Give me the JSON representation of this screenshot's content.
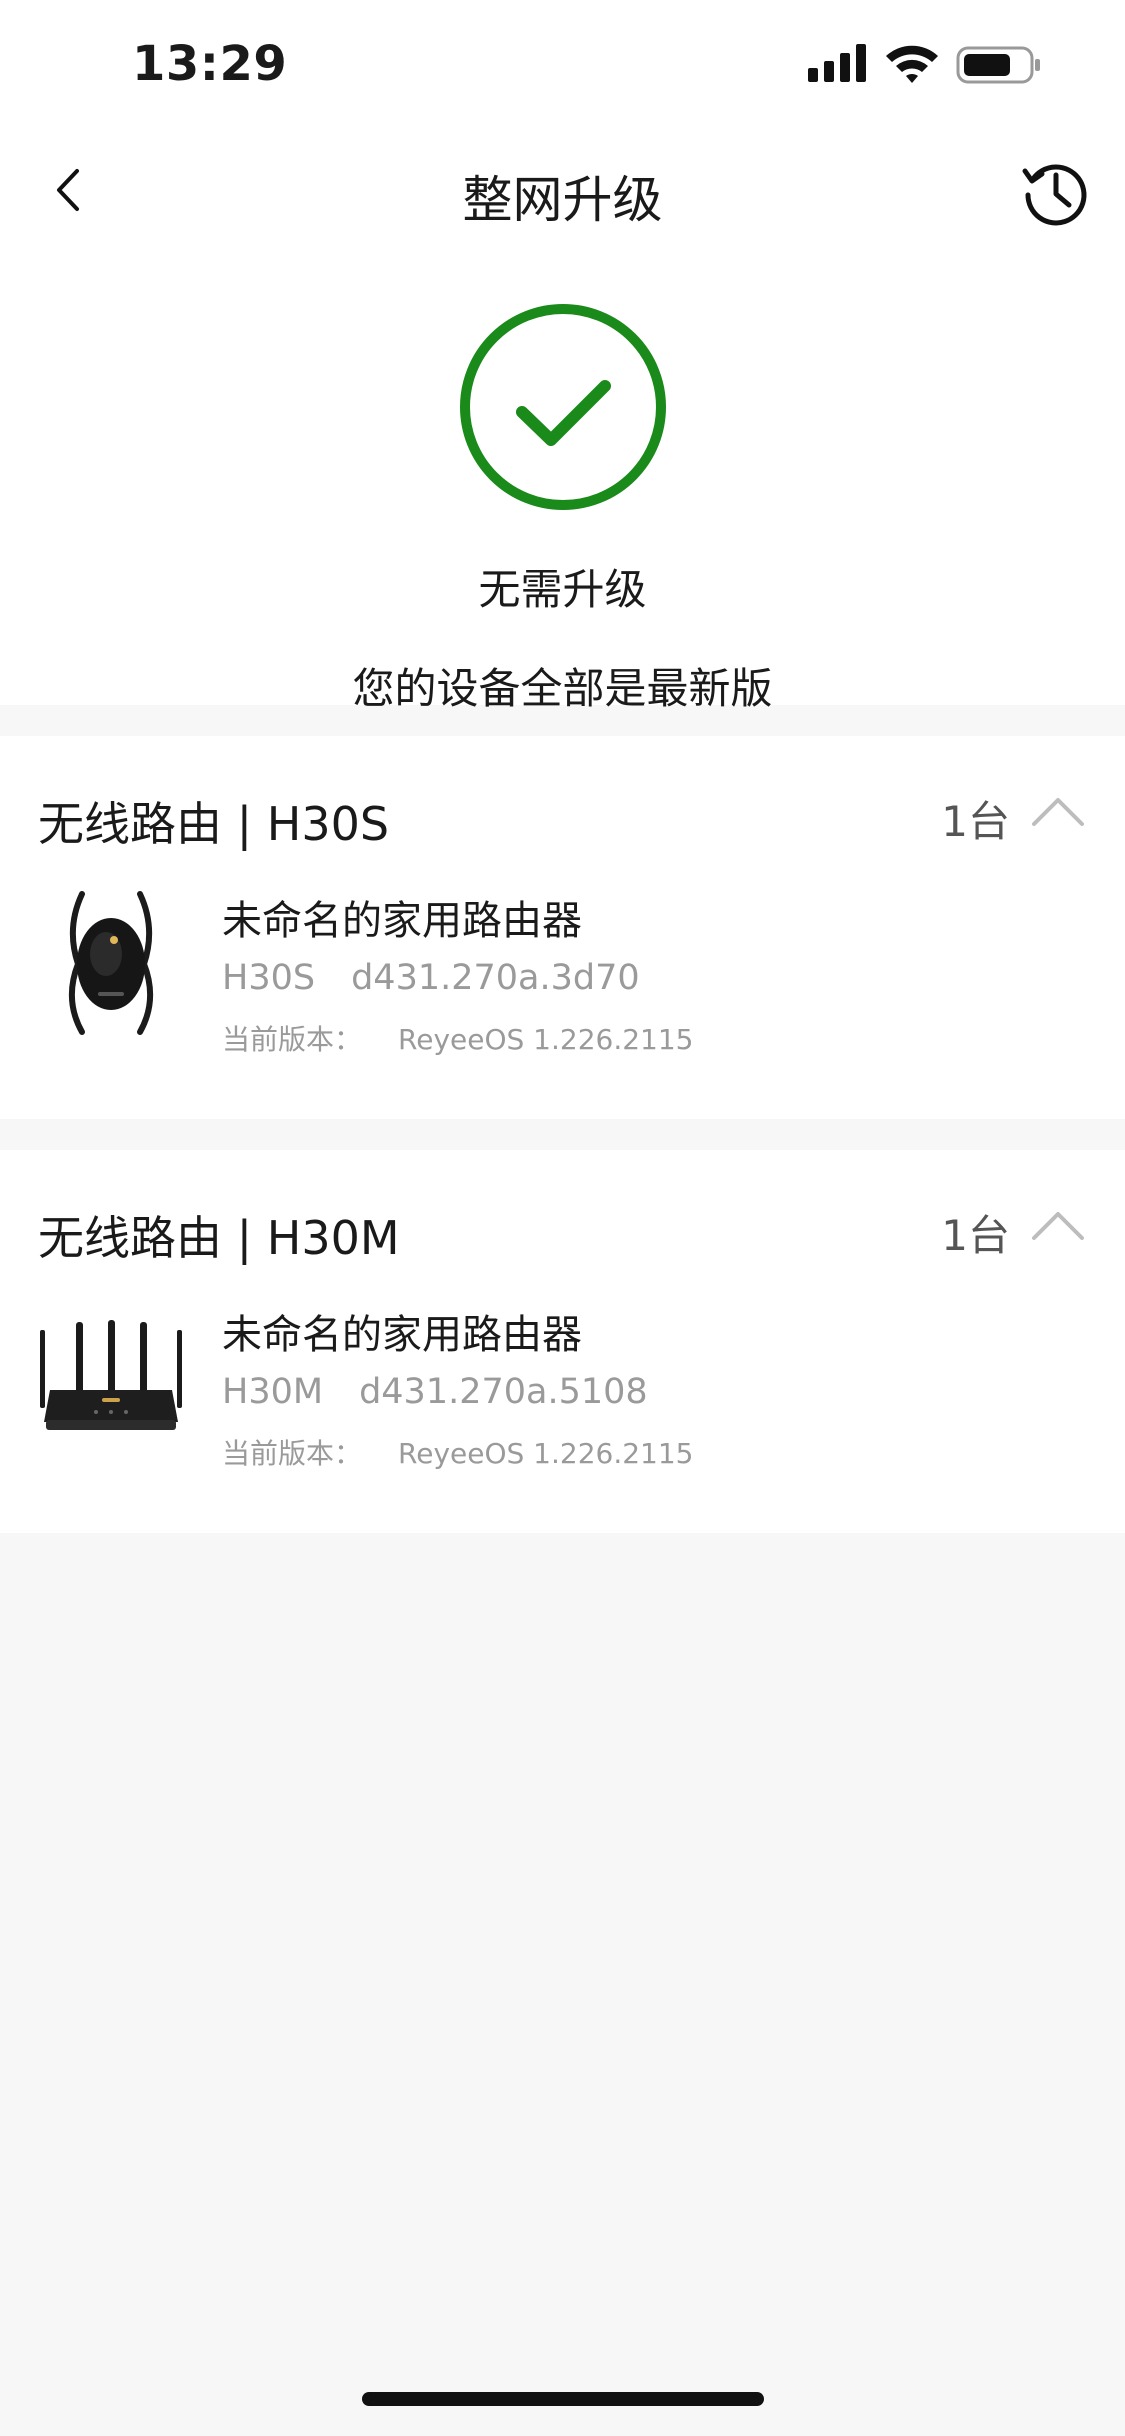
{
  "status_bar": {
    "time": "13:29"
  },
  "nav": {
    "title": "整网升级"
  },
  "status": {
    "title": "无需升级",
    "subtitle": "您的设备全部是最新版",
    "accent_color": "#1a8a1a"
  },
  "devices": [
    {
      "category": "无线路由 | H30S",
      "count": "1台",
      "name": "未命名的家用路由器",
      "model": "H30S",
      "serial": "d431.270a.3d70",
      "version_label": "当前版本：",
      "version": "ReyeeOS 1.226.2115",
      "image_icon": "mesh-router-image"
    },
    {
      "category": "无线路由 | H30M",
      "count": "1台",
      "name": "未命名的家用路由器",
      "model": "H30M",
      "serial": "d431.270a.5108",
      "version_label": "当前版本：",
      "version": "ReyeeOS 1.226.2115",
      "image_icon": "router-image"
    }
  ]
}
